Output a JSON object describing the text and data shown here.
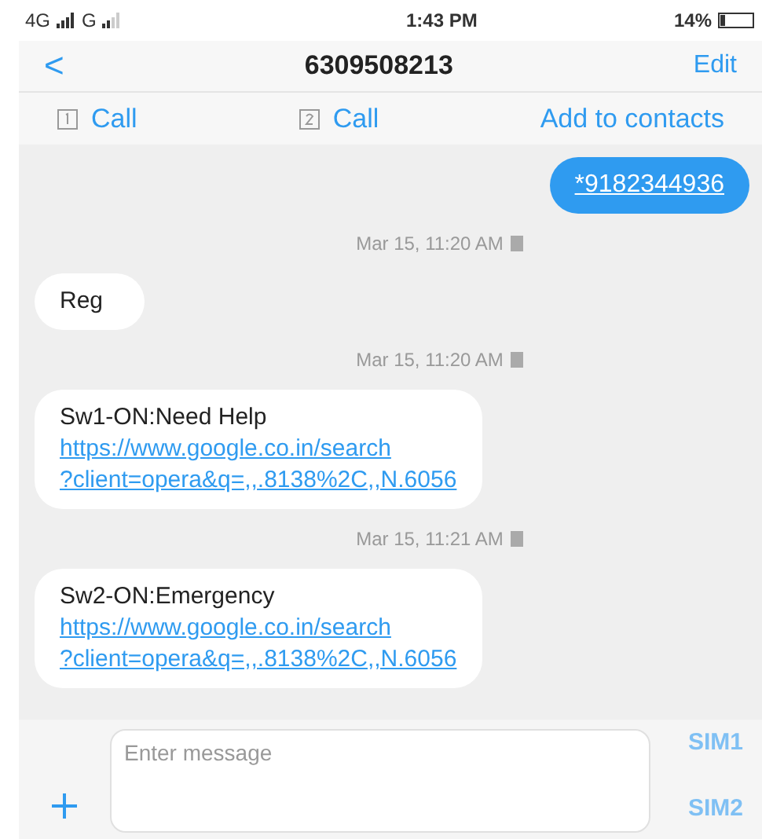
{
  "status_bar": {
    "network_1": "4G",
    "network_2": "G",
    "time": "1:43 PM",
    "battery": "14%"
  },
  "header": {
    "back": "<",
    "title": "6309508213",
    "edit": "Edit"
  },
  "actions": [
    {
      "kind": "sim1",
      "label": "Call"
    },
    {
      "kind": "sim2",
      "label": "Call"
    },
    {
      "kind": "plain",
      "label": "Add to contacts"
    }
  ],
  "messages": [
    {
      "kind": "sent",
      "text": "*9182344936"
    },
    {
      "kind": "timestamp",
      "text": "Mar 15, 11:20 AM"
    },
    {
      "kind": "received",
      "text": "Reg"
    },
    {
      "kind": "timestamp",
      "text": "Mar 15, 11:20 AM"
    },
    {
      "kind": "received",
      "text": "Sw1-ON:Need Help",
      "link_lines": [
        "https://www.google.co.in/search",
        "?client=opera&q=,,.8138%2C,,N.6056"
      ]
    },
    {
      "kind": "timestamp",
      "text": "Mar 15, 11:21 AM"
    },
    {
      "kind": "received",
      "text": "Sw2-ON:Emergency",
      "link_lines": [
        "https://www.google.co.in/search",
        "?client=opera&q=,,.8138%2C,,N.6056"
      ]
    }
  ],
  "composer": {
    "placeholder": "Enter message",
    "send_1": "SIM1",
    "send_2": "SIM2"
  }
}
